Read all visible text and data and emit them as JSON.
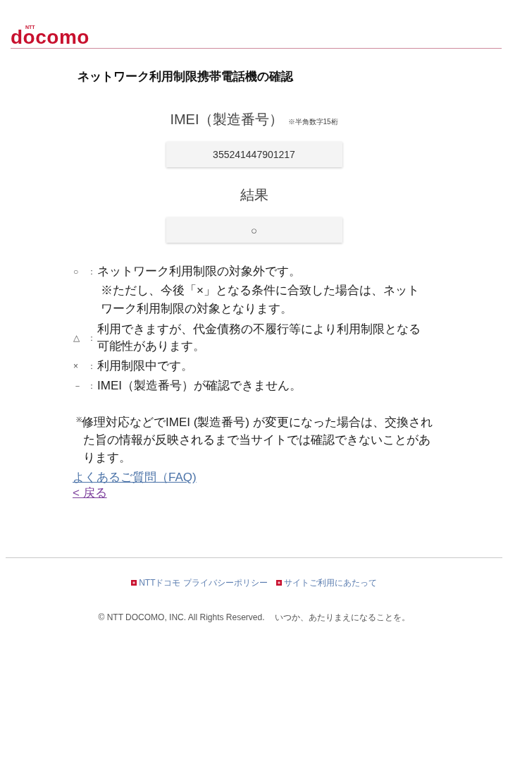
{
  "header": {
    "logo": {
      "ntt": "NTT",
      "wordmark": "docomo"
    }
  },
  "title": "ネットワーク利用制限携帯電話機の確認",
  "imei": {
    "label": "IMEI（製造番号）",
    "hint": "※半角数字15桁",
    "value": "355241447901217"
  },
  "result": {
    "label": "結果",
    "value": "○"
  },
  "legend": [
    {
      "symbol": "○",
      "colon": "：",
      "text": "ネットワーク利用制限の対象外です。",
      "note": "※ただし、今後「×」となる条件に合致した場合は、ネットワーク利用制限の対象となります。"
    },
    {
      "symbol": "△",
      "colon": "：",
      "text": "利用できますが、代金債務の不履行等により利用制限となる可能性があります。"
    },
    {
      "symbol": "×",
      "colon": "：",
      "text": "利用制限中です。"
    },
    {
      "symbol": "－",
      "colon": "：",
      "text": "IMEI（製造番号）が確認できません。"
    }
  ],
  "notice": "$^{※}$修理対応などでIMEI (製造番号) が変更になった場合は、交換された旨の情報が反映されるまで当サイトでは確認できないことがあります。",
  "links": [
    {
      "label": "よくあるご質問（FAQ)",
      "visited": false
    },
    {
      "label": "< 戻る",
      "visited": true
    }
  ],
  "footer": {
    "links": [
      {
        "label": "NTTドコモ プライバシーポリシー"
      },
      {
        "label": "サイトご利用にあたって"
      }
    ],
    "copyright": "© NTT DOCOMO, INC. All Rights Reserved.",
    "tagline": "いつか、あたりまえになることを。"
  }
}
